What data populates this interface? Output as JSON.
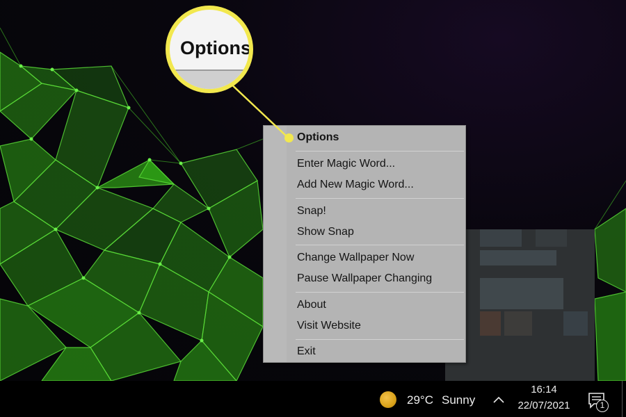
{
  "callout": {
    "label": "Options"
  },
  "menu": {
    "groups": [
      {
        "items": [
          {
            "label": "Options",
            "bold": true
          }
        ]
      },
      {
        "items": [
          {
            "label": "Enter Magic Word..."
          },
          {
            "label": "Add New Magic Word..."
          }
        ]
      },
      {
        "items": [
          {
            "label": "Snap!"
          },
          {
            "label": "Show Snap"
          }
        ]
      },
      {
        "items": [
          {
            "label": "Change Wallpaper Now"
          },
          {
            "label": "Pause Wallpaper Changing"
          }
        ]
      },
      {
        "items": [
          {
            "label": "About"
          },
          {
            "label": "Visit Website"
          }
        ]
      },
      {
        "items": [
          {
            "label": "Exit"
          }
        ]
      }
    ]
  },
  "taskbar": {
    "weather": {
      "icon": "sun-icon",
      "temperature": "29°C",
      "condition": "Sunny"
    },
    "tray_chevron_icon": "chevron-up-icon",
    "clock": {
      "time": "16:14",
      "date": "22/07/2021"
    },
    "notifications": {
      "icon": "notification-icon",
      "count": "1"
    }
  },
  "colors": {
    "highlight_yellow": "#f2e84e",
    "menu_background": "#b4b4b4",
    "taskbar": "#000000",
    "wallpaper_green": "#3fb81c"
  }
}
